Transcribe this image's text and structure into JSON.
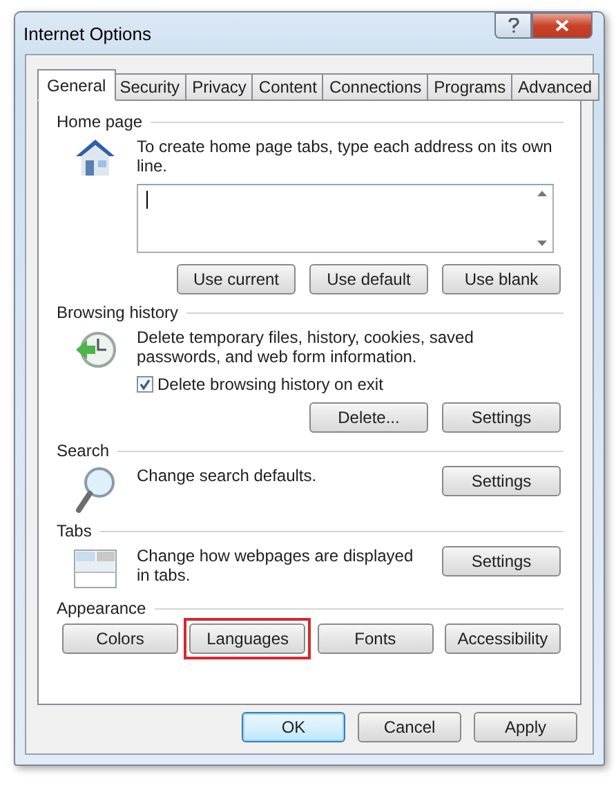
{
  "window": {
    "title": "Internet Options"
  },
  "tabs": [
    {
      "label": "General",
      "selected": true
    },
    {
      "label": "Security",
      "selected": false
    },
    {
      "label": "Privacy",
      "selected": false
    },
    {
      "label": "Content",
      "selected": false
    },
    {
      "label": "Connections",
      "selected": false
    },
    {
      "label": "Programs",
      "selected": false
    },
    {
      "label": "Advanced",
      "selected": false
    }
  ],
  "sections": [
    {
      "kind": "home",
      "heading": "Home page",
      "description": "To create home page tabs, type each address on its own line.",
      "buttons": [
        {
          "label": "Use current",
          "highlighted": false
        },
        {
          "label": "Use default",
          "highlighted": false
        },
        {
          "label": "Use blank",
          "highlighted": false
        }
      ]
    },
    {
      "kind": "history",
      "heading": "Browsing history",
      "description": "Delete temporary files, history, cookies, saved passwords, and web form information.",
      "checkbox": {
        "label": "Delete browsing history on exit",
        "checked": true
      },
      "buttons": [
        {
          "label": "Delete...",
          "highlighted": false
        },
        {
          "label": "Settings",
          "highlighted": false
        }
      ]
    },
    {
      "kind": "search",
      "heading": "Search",
      "description": "Change search defaults.",
      "buttons": [
        {
          "label": "Settings",
          "highlighted": false
        }
      ]
    },
    {
      "kind": "tabs",
      "heading": "Tabs",
      "description": "Change how webpages are displayed in tabs.",
      "buttons": [
        {
          "label": "Settings",
          "highlighted": false
        }
      ]
    },
    {
      "kind": "appearance",
      "heading": "Appearance",
      "buttons": [
        {
          "label": "Colors",
          "highlighted": false
        },
        {
          "label": "Languages",
          "highlighted": true
        },
        {
          "label": "Fonts",
          "highlighted": false
        },
        {
          "label": "Accessibility",
          "highlighted": false
        }
      ]
    }
  ],
  "dialog_buttons": [
    {
      "label": "OK",
      "default": true
    },
    {
      "label": "Cancel",
      "default": false
    },
    {
      "label": "Apply",
      "default": false
    }
  ]
}
